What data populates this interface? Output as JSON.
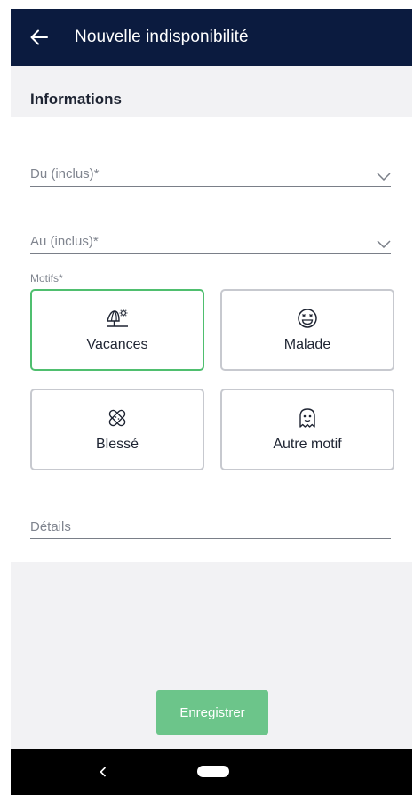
{
  "header": {
    "title": "Nouvelle indisponibilité"
  },
  "section": {
    "title": "Informations"
  },
  "form": {
    "from_label": "Du (inclus)*",
    "to_label": "Au (inclus)*",
    "reasons_label": "Motifs*",
    "reasons": [
      {
        "label": "Vacances",
        "icon": "beach-umbrella-icon",
        "selected": true
      },
      {
        "label": "Malade",
        "icon": "sick-face-icon",
        "selected": false
      },
      {
        "label": "Blessé",
        "icon": "bandage-icon",
        "selected": false
      },
      {
        "label": "Autre motif",
        "icon": "ghost-icon",
        "selected": false
      }
    ],
    "details_placeholder": "Détails"
  },
  "actions": {
    "save_label": "Enregistrer"
  },
  "colors": {
    "topbar": "#0b1b3f",
    "accent": "#4fbf6f",
    "save_button": "#6cc58a"
  }
}
